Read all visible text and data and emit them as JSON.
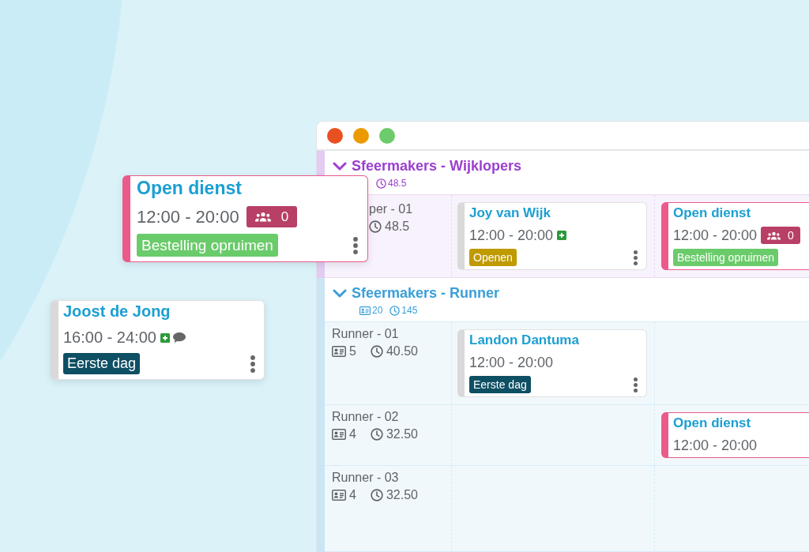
{
  "window": {
    "controls": [
      {
        "color": "#e8501f"
      },
      {
        "color": "#eb9b00"
      },
      {
        "color": "#6ccb6a"
      }
    ]
  },
  "groups": [
    {
      "title": "Sfeermakers - Wijklopers",
      "expanded": true,
      "color": "#9b3fd0",
      "stats": [
        {
          "kind": "hours",
          "value": "48.5"
        }
      ],
      "rows": [
        {
          "label": "per - 01",
          "stats": [
            {
              "kind": "hours",
              "value": "48.5"
            }
          ],
          "column_2": {
            "kind": "assigned",
            "name": "Joy van Wijk",
            "time": "12:00 - 20:00",
            "extra": true,
            "note": false,
            "tag": {
              "label": "Openen",
              "color": "#bf9a00"
            },
            "menu": true
          },
          "column_3": {
            "kind": "open",
            "name": "Open dienst",
            "time": "12:00 - 20:00",
            "extra": false,
            "note": false,
            "badge": "0",
            "tag": {
              "label": "Bestelling opruimen",
              "color": "#6acb6a"
            },
            "menu": false
          }
        }
      ]
    },
    {
      "title": "Sfeermakers - Runner",
      "expanded": true,
      "color": "#3a9fd8",
      "stats": [
        {
          "kind": "employees",
          "value": "20"
        },
        {
          "kind": "hours",
          "value": "145"
        }
      ],
      "rows": [
        {
          "label": "Runner - 01",
          "stats": [
            {
              "kind": "employees",
              "value": "5"
            },
            {
              "kind": "hours",
              "value": "40.50"
            }
          ],
          "column_2": {
            "kind": "assigned",
            "name": "Landon Dantuma",
            "time": "12:00 - 20:00",
            "extra": false,
            "note": false,
            "tag": {
              "label": "Eerste dag",
              "color": "#0e4f63"
            },
            "menu": true
          }
        },
        {
          "label": "Runner - 02",
          "stats": [
            {
              "kind": "employees",
              "value": "4"
            },
            {
              "kind": "hours",
              "value": "32.50"
            }
          ],
          "column_3": {
            "kind": "open",
            "name": "Open dienst",
            "time": "12:00 - 20:00",
            "extra": false,
            "note": false,
            "menu": false
          }
        },
        {
          "label": "Runner - 03",
          "stats": [
            {
              "kind": "employees",
              "value": "4"
            },
            {
              "kind": "hours",
              "value": "32.50"
            }
          ]
        }
      ]
    }
  ],
  "dragged_cards": [
    {
      "kind": "open",
      "name": "Open dienst",
      "time": "12:00 - 20:00",
      "extra": false,
      "note": false,
      "badge": "0",
      "tag": {
        "label": "Bestelling opruimen",
        "color": "#6acb6a"
      },
      "menu": true
    },
    {
      "kind": "assigned",
      "name": "Joost de Jong",
      "time": "16:00 - 24:00",
      "extra": true,
      "note": true,
      "tag": {
        "label": "Eerste dag",
        "color": "#0e4f63"
      },
      "menu": true
    }
  ]
}
